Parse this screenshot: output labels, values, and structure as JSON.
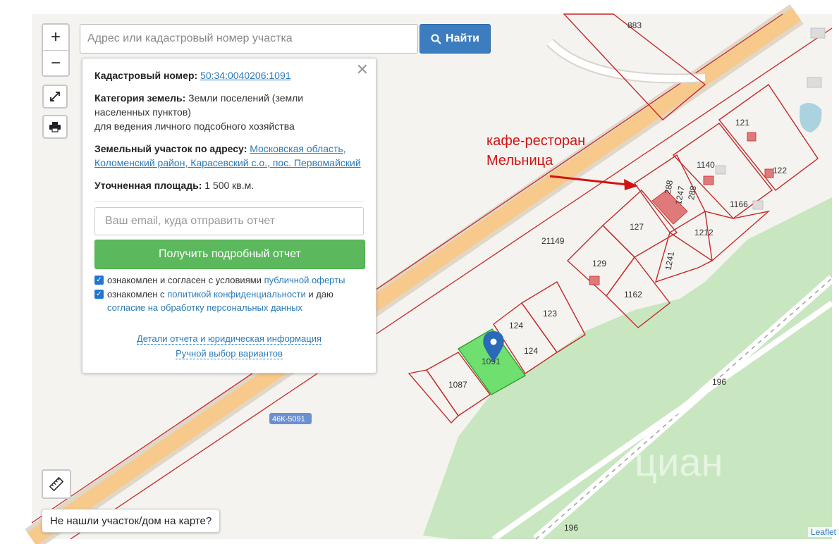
{
  "search": {
    "placeholder": "Адрес или кадастровый номер участка",
    "button_label": "Найти"
  },
  "zoom": {
    "in_label": "+",
    "out_label": "−"
  },
  "popup": {
    "cad_label": "Кадастровый номер:",
    "cad_value": "50:34:0040206:1091",
    "cat_label": "Категория земель:",
    "cat_value": "Земли поселений (земли населенных пунктов)",
    "cat_use": "для ведения личного подсобного хозяйства",
    "addr_label": "Земельный участок по адресу:",
    "addr_value": "Московская область, Коломенский район, Карасевский с.о., пос. Первомайский",
    "area_label": "Уточненная площадь:",
    "area_value": "1 500 кв.м.",
    "email_placeholder": "Ваш email, куда отправить отчет",
    "report_button": "Получить подробный отчет",
    "consent1_text": "ознакомлен и согласен с условиями",
    "consent1_link": "публичной оферты",
    "consent2_text": "ознакомлен с",
    "consent2_link": "политикой конфиденциальности",
    "consent2_mid": "и даю",
    "consent2_link2": "согласие на обработку персональных данных",
    "details_link": "Детали отчета и юридическая информация",
    "manual_link": "Ручной выбор вариантов"
  },
  "annotation": {
    "line1": "кафе-ресторан",
    "line2": "Мельница"
  },
  "map": {
    "road_badge": "46К-5091",
    "watermark": "циан",
    "colors": {
      "forest": "#c8e6c0",
      "road": "#f7c98b",
      "boundary": "#c62828",
      "selected": "#6fe06f"
    },
    "plot_labels": {
      "p883": "883",
      "p121": "121",
      "p122": "122",
      "p1140": "1140",
      "p288a": "288",
      "p1247": "1247",
      "p288b": "288",
      "p1166": "1166",
      "p127": "127",
      "p1212": "1212",
      "p21149": "21149",
      "p129": "129",
      "p1241": "1241",
      "p1162": "1162",
      "p123": "123",
      "p124a": "124",
      "p124b": "124",
      "p1091": "1091",
      "p1087": "1087",
      "p196a": "196",
      "p196b": "196"
    }
  },
  "not_found": "Не нашли участок/дом на карте?",
  "attribution": "Leaflet"
}
